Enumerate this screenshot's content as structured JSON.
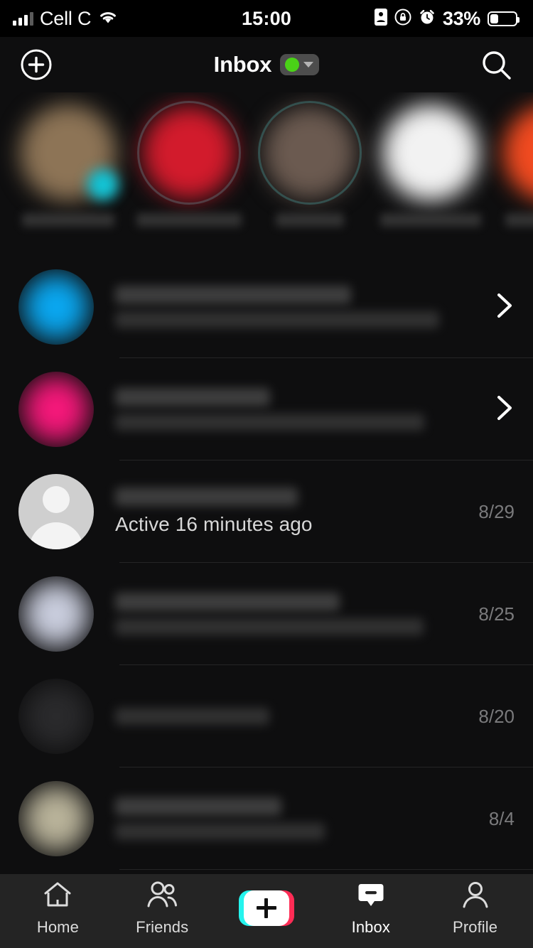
{
  "status_bar": {
    "carrier": "Cell C",
    "signal_icon": "cellular-signal-icon",
    "wifi_icon": "wifi-icon",
    "time": "15:00",
    "indicators": [
      {
        "icon": "id-card-icon"
      },
      {
        "icon": "rotation-lock-icon"
      },
      {
        "icon": "alarm-clock-icon"
      }
    ],
    "battery_percent": "33%",
    "battery_icon": "battery-icon"
  },
  "header": {
    "add_icon": "plus-circle-icon",
    "title": "Inbox",
    "status_pill": {
      "dot_color": "#4ad217",
      "caret_icon": "chevron-down-icon"
    },
    "search_icon": "search-icon"
  },
  "stories": {
    "items": [
      {
        "name": "",
        "avatar_color": "#8d7456",
        "has_ring": false,
        "has_badge": true,
        "badge_color": "#12c4d6"
      },
      {
        "name": "",
        "avatar_color": "#d21b2c",
        "has_ring": true,
        "has_badge": false
      },
      {
        "name": "",
        "avatar_color": "#6b5a50",
        "has_ring": true,
        "has_badge": false
      },
      {
        "name": "",
        "avatar_color": "#f2f2f2",
        "has_ring": false,
        "has_badge": false
      },
      {
        "name": "",
        "avatar_color": "#f04a20",
        "has_ring": false,
        "has_badge": false
      }
    ]
  },
  "messages": {
    "rows": [
      {
        "avatar_type": "color",
        "avatar_color": "#0aa7f0",
        "title": "",
        "subtitle": "",
        "subtitle_visible": false,
        "date": "",
        "accessory": "chevron-right-icon"
      },
      {
        "avatar_type": "color",
        "avatar_color": "#f5187a",
        "title": "",
        "subtitle": "",
        "subtitle_visible": false,
        "date": "",
        "accessory": "chevron-right-icon"
      },
      {
        "avatar_type": "default",
        "avatar_color": "#cfcfcf",
        "title": "",
        "subtitle": "Active 16 minutes ago",
        "subtitle_visible": true,
        "date": "8/29",
        "accessory": "none"
      },
      {
        "avatar_type": "color",
        "avatar_color": "#c9cddd",
        "title": "",
        "subtitle": "",
        "subtitle_visible": false,
        "date": "8/25",
        "accessory": "none"
      },
      {
        "avatar_type": "color",
        "avatar_color": "#2a2a2c",
        "title": "",
        "subtitle": "",
        "subtitle_visible": false,
        "date": "8/20",
        "accessory": "none"
      },
      {
        "avatar_type": "color",
        "avatar_color": "#b9b39a",
        "title": "",
        "subtitle": "",
        "subtitle_visible": false,
        "date": "8/4",
        "accessory": "none"
      }
    ]
  },
  "tab_bar": {
    "tabs": [
      {
        "label": "Home",
        "icon": "home-icon",
        "active": false
      },
      {
        "label": "Friends",
        "icon": "friends-icon",
        "active": false
      },
      {
        "label": "",
        "icon": "create-plus-button",
        "active": false
      },
      {
        "label": "Inbox",
        "icon": "inbox-bubble-icon",
        "active": true
      },
      {
        "label": "Profile",
        "icon": "profile-person-icon",
        "active": false
      }
    ]
  }
}
